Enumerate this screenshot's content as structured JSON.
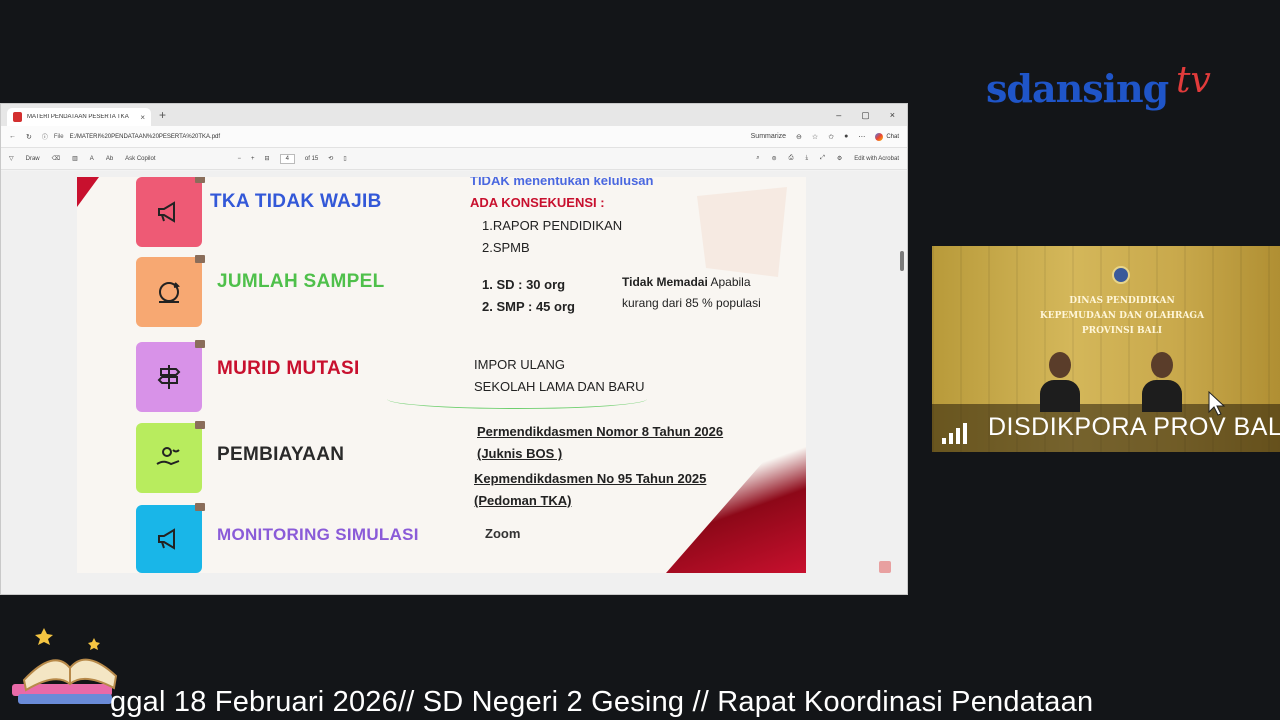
{
  "browser": {
    "tab_title": "MATERI PENDATAAN PESERTA TKA",
    "tab_close": "×",
    "new_tab": "+",
    "window_controls": [
      "–",
      "▢",
      "×"
    ],
    "url_prefix": "File",
    "url": "E:/MATERI%20PENDATAAN%20PESERTA%20TKA.pdf",
    "summarize_label": "Summarize",
    "chat_label": "Chat",
    "pdf_toolbar": {
      "draw_label": "Draw",
      "ask_copilot_label": "Ask Copilot",
      "page_current": "4",
      "page_total": "of 15",
      "edit_acrobat_label": "Edit with Acrobat"
    }
  },
  "slide": {
    "items": [
      {
        "label": "TKA TIDAK WAJIB",
        "icon": "megaphone-icon"
      },
      {
        "label": "JUMLAH SAMPEL",
        "icon": "refresh-icon"
      },
      {
        "label": "MURID MUTASI",
        "icon": "signpost-icon"
      },
      {
        "label": "PEMBIAYAAN",
        "icon": "money-hand-icon"
      },
      {
        "label": "MONITORING SIMULASI",
        "icon": "megaphone-icon"
      }
    ],
    "tka": {
      "line1": "TIDAK menentukan kelulusan",
      "line2": "ADA KONSEKUENSI  :",
      "line3": "1.RAPOR PENDIDIKAN",
      "line4": "2.SPMB"
    },
    "sampel": {
      "sd": "1.  SD     : 30  org",
      "smp": "2.  SMP  : 45 org",
      "note_bold": "Tidak Memadai",
      "note_rest": " Apabila",
      "note_line2": "kurang dari 85 % populasi"
    },
    "mutasi": {
      "line1": "IMPOR ULANG",
      "line2": "SEKOLAH LAMA DAN BARU"
    },
    "pembiayaan": {
      "line1": "Permendikdasmen Nomor 8 Tahun 2026",
      "line2": "(Juknis BOS )",
      "line3": "Kepmendikdasmen No 95 Tahun 2025",
      "line4": "(Pedoman TKA)"
    },
    "monitoring": {
      "line1": "Zoom"
    }
  },
  "broadcast": {
    "brand_main": "sdansing",
    "brand_tv": "tv",
    "cam_title_line1": "DINAS PENDIDIKAN",
    "cam_title_line2": "KEPEMUDAAN DAN OLAHRAGA",
    "cam_title_line3": "PROVINSI BALI",
    "cam_label": "DISDIKPORA PROV BALI",
    "ticker": "ggal 18 Februari 2026// SD Negeri 2 Gesing // Rapat Koordinasi Pendataan"
  }
}
